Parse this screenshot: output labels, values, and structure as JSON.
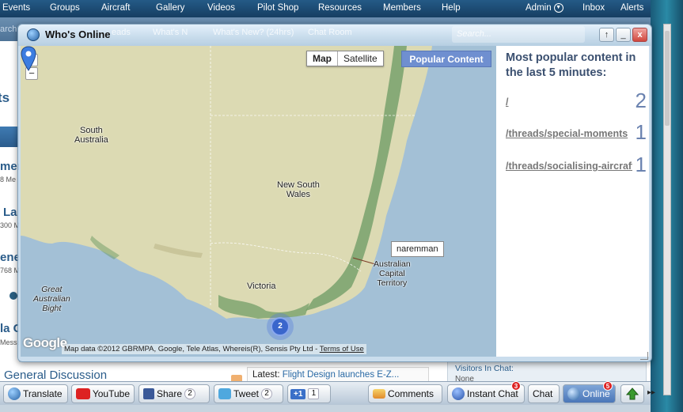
{
  "topnav": {
    "items": [
      "Events",
      "Groups",
      "Aircraft",
      "Gallery",
      "Videos",
      "Pilot Shop",
      "Resources",
      "Members",
      "Help"
    ],
    "admin_label": "Admin",
    "inbox_label": "Inbox",
    "alerts_label": "Alerts"
  },
  "subnav": {
    "partial_search": "arch T"
  },
  "background": {
    "left_fragments": [
      "ts",
      "men",
      "8 Me",
      "La",
      "300 M",
      "ene",
      "768 M",
      "la C",
      "Messa"
    ],
    "general_discussion": "General Discussion",
    "latest_prefix": "Latest:",
    "latest_link": "Flight Design launches E-Z...",
    "visitors_in_chat": "Visitors In Chat:",
    "none_label": "None"
  },
  "window": {
    "title": "Who's Online",
    "ghost_tabs": [
      "eads",
      "What's N",
      "What's New? (24hrs)",
      "Chat Room"
    ],
    "ghost_search": "Search...",
    "buttons": {
      "up": "↑",
      "minimize": "_",
      "close": "x"
    }
  },
  "map": {
    "zoom_in": "+",
    "zoom_out": "−",
    "type_map": "Map",
    "type_satellite": "Satellite",
    "popular_button": "Popular Content",
    "labels": {
      "south_australia": "South\nAustralia",
      "nsw": "New South\nWales",
      "victoria": "Victoria",
      "act": "Australian\nCapital\nTerritory",
      "great_australian_bight": "Great\nAustralian\nBight"
    },
    "marker_name": "naremman",
    "cluster_count": "2",
    "google_logo": "Google",
    "attribution": "Map data ©2012 GBRMPA, Google, Tele Atlas, Whereis(R), Sensis Pty Ltd -",
    "terms_label": "Terms of Use",
    "colors": {
      "water": "#a3c0d6",
      "land": "#dcdab3",
      "forest": "#6b9a63"
    }
  },
  "popular": {
    "heading": "Most popular content in the last 5 minutes:",
    "rows": [
      {
        "path": "/",
        "count": "2"
      },
      {
        "path": "/threads/special-moments",
        "count": "1"
      },
      {
        "path": "/threads/socialising-aircraft",
        "count": "1"
      }
    ]
  },
  "toolbar": {
    "translate": "Translate",
    "youtube": "YouTube",
    "share": "Share",
    "share_count": "2",
    "tweet": "Tweet",
    "tweet_count": "2",
    "plusone": "+1",
    "plusone_count": "1",
    "comments": "Comments",
    "instant_chat": "Instant Chat",
    "instant_chat_badge": "3",
    "chat": "Chat",
    "online": "Online",
    "online_badge": "5",
    "more": "▸▸"
  }
}
